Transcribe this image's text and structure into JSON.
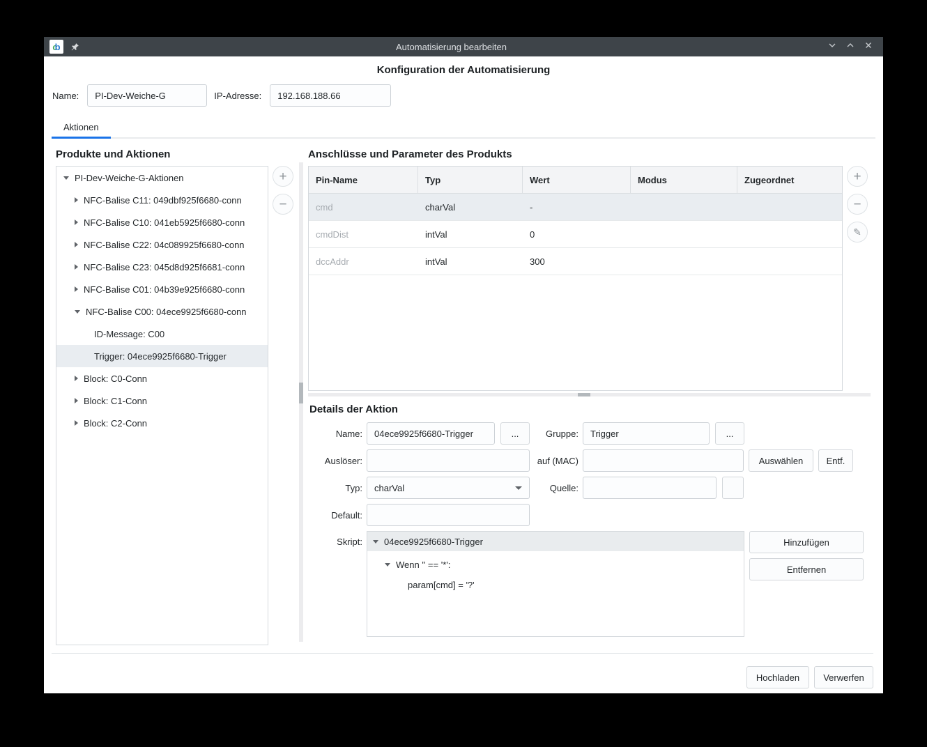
{
  "colors": {
    "accent": "#1a73e8",
    "titlebar": "#3e4449",
    "selection": "#e9edf1"
  },
  "titlebar": {
    "title": "Automatisierung bearbeiten"
  },
  "page": {
    "heading": "Konfiguration der Automatisierung"
  },
  "config": {
    "name_label": "Name:",
    "name_value": "PI-Dev-Weiche-G",
    "ip_label": "IP-Adresse:",
    "ip_value": "192.168.188.66"
  },
  "tabs": {
    "aktionen": "Aktionen"
  },
  "icons": {
    "add": "+",
    "remove": "−",
    "edit": "✎"
  },
  "products": {
    "heading": "Produkte und Aktionen",
    "tree": [
      {
        "label": "PI-Dev-Weiche-G-Aktionen"
      },
      {
        "label": "NFC-Balise C11: 049dbf925f6680-conn"
      },
      {
        "label": "NFC-Balise C10: 041eb5925f6680-conn"
      },
      {
        "label": "NFC-Balise C22: 04c089925f6680-conn"
      },
      {
        "label": "NFC-Balise C23: 045d8d925f6681-conn"
      },
      {
        "label": "NFC-Balise C01: 04b39e925f6680-conn"
      },
      {
        "label": "NFC-Balise C00: 04ece9925f6680-conn"
      },
      {
        "label": "ID-Message: C00"
      },
      {
        "label": "Trigger: 04ece9925f6680-Trigger"
      },
      {
        "label": "Block: C0-Conn"
      },
      {
        "label": "Block: C1-Conn"
      },
      {
        "label": "Block: C2-Conn"
      }
    ]
  },
  "pins": {
    "heading": "Anschlüsse und Parameter des Produkts",
    "headers": [
      "Pin-Name",
      "Typ",
      "Wert",
      "Modus",
      "Zugeordnet"
    ],
    "rows": [
      {
        "pin": "cmd",
        "typ": "charVal",
        "wert": "-",
        "modus": "",
        "zugeordnet": ""
      },
      {
        "pin": "cmdDist",
        "typ": "intVal",
        "wert": "0",
        "modus": "",
        "zugeordnet": ""
      },
      {
        "pin": "dccAddr",
        "typ": "intVal",
        "wert": "300",
        "modus": "",
        "zugeordnet": ""
      }
    ]
  },
  "details": {
    "heading": "Details der Aktion",
    "name_label": "Name:",
    "name_value": "04ece9925f6680-Trigger",
    "more": "...",
    "gruppe_label": "Gruppe:",
    "gruppe_value": "Trigger",
    "ausloeser_label": "Auslöser:",
    "auf_mac_label": "auf (MAC)",
    "auswaehlen": "Auswählen",
    "entf": "Entf.",
    "typ_label": "Typ:",
    "typ_value": "charVal",
    "quelle_label": "Quelle:",
    "default_label": "Default:",
    "skript_label": "Skript:",
    "script_root": "04ece9925f6680-Trigger",
    "script_condition": "Wenn '' == '*':",
    "script_statement": "param[cmd] = '?'",
    "hinzufuegen": "Hinzufügen",
    "entfernen": "Entfernen"
  },
  "footer": {
    "hochladen": "Hochladen",
    "verwerfen": "Verwerfen"
  }
}
